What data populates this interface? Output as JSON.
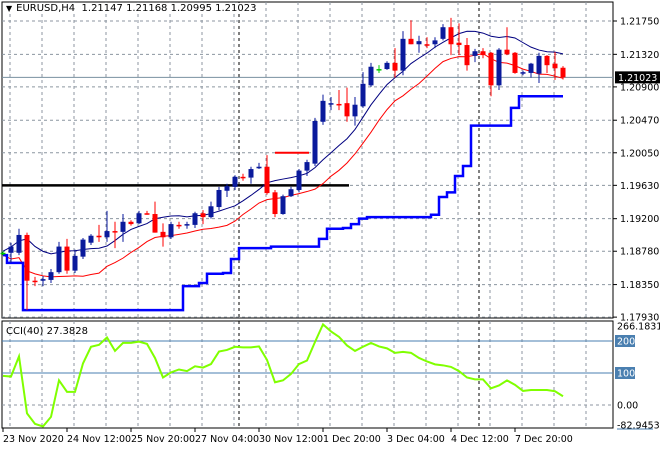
{
  "header": {
    "symbol": "EURUSD,H4",
    "ohlc": "1.21147 1.21168 1.20995 1.21023"
  },
  "cci_header": {
    "label": "CCI(40)",
    "value": "27.3828"
  },
  "current_price_label": "1.21023",
  "colors": {
    "bull": "#0a1a9c",
    "bear": "#ff0000",
    "doji": "#00cc00",
    "upper_ma": "#000080",
    "lower_ma": "#ff0000",
    "channel_low": "#0000ff",
    "cci": "#80ff00",
    "level_fill": "#4a7fb0"
  },
  "chart_data": [
    {
      "type": "candlestick",
      "title": "EURUSD,H4",
      "y_ticks": [
        "1.21750",
        "1.21320",
        "1.20900",
        "1.20470",
        "1.20050",
        "1.19630",
        "1.19200",
        "1.18780",
        "1.18350",
        "1.17930"
      ],
      "y_tick_values": [
        1.2175,
        1.2132,
        1.209,
        1.2047,
        1.2005,
        1.1963,
        1.192,
        1.1878,
        1.1835,
        1.1793
      ],
      "x_labels": [
        "23 Nov 2020",
        "24 Nov 12:00",
        "25 Nov 20:00",
        "27 Nov 04:00",
        "30 Nov 12:00",
        "1 Dec 20:00",
        "3 Dec 04:00",
        "4 Dec 12:00",
        "7 Dec 20:00"
      ],
      "x_label_candle_index": [
        0,
        8,
        16,
        24,
        32,
        40,
        48,
        56,
        64
      ],
      "period_separators_candle_index": [
        29,
        59
      ],
      "horizontal_lines": [
        {
          "price": 1.1963,
          "color": "#000000",
          "from_index": 0,
          "to_index": 43
        },
        {
          "price": 1.2005,
          "color": "#ff0000",
          "from_index": 34,
          "to_index": 38
        }
      ],
      "ohlc": [
        [
          1.1876,
          1.1878,
          1.1873,
          1.1876
        ],
        [
          1.1876,
          1.1889,
          1.1863,
          1.1884
        ],
        [
          1.1876,
          1.1907,
          1.1873,
          1.1899
        ],
        [
          1.1899,
          1.1902,
          1.1802,
          1.184
        ],
        [
          1.184,
          1.1845,
          1.1833,
          1.1839
        ],
        [
          1.184,
          1.1846,
          1.1833,
          1.1842
        ],
        [
          1.1841,
          1.1855,
          1.1837,
          1.1851
        ],
        [
          1.1851,
          1.189,
          1.1849,
          1.1884
        ],
        [
          1.1884,
          1.1894,
          1.1849,
          1.1853
        ],
        [
          1.1853,
          1.188,
          1.185,
          1.1872
        ],
        [
          1.1871,
          1.1895,
          1.1868,
          1.1893
        ],
        [
          1.1889,
          1.19,
          1.1886,
          1.1898
        ],
        [
          1.1898,
          1.1912,
          1.189,
          1.1896
        ],
        [
          1.1896,
          1.193,
          1.189,
          1.1904
        ],
        [
          1.1904,
          1.1916,
          1.1882,
          1.1903
        ],
        [
          1.1903,
          1.1926,
          1.189,
          1.1916
        ],
        [
          1.1916,
          1.1918,
          1.1911,
          1.1913
        ],
        [
          1.1914,
          1.193,
          1.1913,
          1.1927
        ],
        [
          1.1927,
          1.193,
          1.1925,
          1.1926
        ],
        [
          1.1926,
          1.1942,
          1.1902,
          1.1902
        ],
        [
          1.1903,
          1.1914,
          1.1884,
          1.1896
        ],
        [
          1.1896,
          1.1916,
          1.1894,
          1.1913
        ],
        [
          1.1912,
          1.1916,
          1.1907,
          1.1911
        ],
        [
          1.1912,
          1.1916,
          1.1907,
          1.1913
        ],
        [
          1.1912,
          1.1929,
          1.1908,
          1.1927
        ],
        [
          1.1927,
          1.1931,
          1.1913,
          1.1922
        ],
        [
          1.1922,
          1.1942,
          1.192,
          1.1936
        ],
        [
          1.1935,
          1.1961,
          1.1931,
          1.1957
        ],
        [
          1.1956,
          1.1965,
          1.1948,
          1.1962
        ],
        [
          1.1961,
          1.1976,
          1.1957,
          1.1974
        ],
        [
          1.1974,
          1.1978,
          1.1969,
          1.1973
        ],
        [
          1.1973,
          1.1987,
          1.1965,
          1.1984
        ],
        [
          1.1985,
          1.1992,
          1.1984,
          1.1987
        ],
        [
          1.1987,
          1.2002,
          1.1951,
          1.1953
        ],
        [
          1.1954,
          1.1957,
          1.1922,
          1.1926
        ],
        [
          1.1926,
          1.1951,
          1.1925,
          1.1949
        ],
        [
          1.1949,
          1.1961,
          1.1948,
          1.1958
        ],
        [
          1.1957,
          1.1984,
          1.1954,
          1.1982
        ],
        [
          1.1982,
          1.1996,
          1.1975,
          1.1993
        ],
        [
          1.1991,
          1.205,
          1.1988,
          1.2046
        ],
        [
          1.2045,
          1.208,
          1.2041,
          1.2072
        ],
        [
          1.2068,
          1.2077,
          1.206,
          1.2069
        ],
        [
          1.2068,
          1.2086,
          1.206,
          1.2067
        ],
        [
          1.2069,
          1.2089,
          1.2045,
          1.2052
        ],
        [
          1.2052,
          1.2077,
          1.204,
          1.2067
        ],
        [
          1.2065,
          1.2109,
          1.2063,
          1.2094
        ],
        [
          1.2092,
          1.2121,
          1.209,
          1.2116
        ],
        [
          1.2113,
          1.2118,
          1.2108,
          1.2113
        ],
        [
          1.2113,
          1.2123,
          1.2112,
          1.2121
        ],
        [
          1.2121,
          1.214,
          1.2102,
          1.2111
        ],
        [
          1.2111,
          1.2162,
          1.2105,
          1.2152
        ],
        [
          1.2152,
          1.2176,
          1.2145,
          1.2145
        ],
        [
          1.2145,
          1.2156,
          1.2134,
          1.2149
        ],
        [
          1.2145,
          1.2154,
          1.214,
          1.2144
        ],
        [
          1.2145,
          1.2154,
          1.214,
          1.215
        ],
        [
          1.2152,
          1.2171,
          1.215,
          1.2167
        ],
        [
          1.2167,
          1.2179,
          1.2131,
          1.2145
        ],
        [
          1.2147,
          1.2172,
          1.2131,
          1.2144
        ],
        [
          1.2144,
          1.2153,
          1.2111,
          1.2118
        ],
        [
          1.213,
          1.2139,
          1.2122,
          1.2136
        ],
        [
          1.2136,
          1.214,
          1.2127,
          1.2131
        ],
        [
          1.2134,
          1.2135,
          1.2078,
          1.2092
        ],
        [
          1.2092,
          1.214,
          1.2086,
          1.2138
        ],
        [
          1.2138,
          1.2167,
          1.2131,
          1.2132
        ],
        [
          1.2134,
          1.2135,
          1.2107,
          1.2108
        ],
        [
          1.2107,
          1.2111,
          1.2105,
          1.2109
        ],
        [
          1.2108,
          1.2121,
          1.2102,
          1.212
        ],
        [
          1.2107,
          1.2134,
          1.2095,
          1.213
        ],
        [
          1.213,
          1.2131,
          1.2108,
          1.2118
        ],
        [
          1.212,
          1.2135,
          1.2099,
          1.2114
        ],
        [
          1.21147,
          1.21168,
          1.20995,
          1.21023
        ]
      ],
      "current_price": 1.21023
    },
    {
      "type": "line",
      "title": "CCI(40)",
      "y_ticks": [
        "266.1831",
        "200",
        "100",
        "0.00",
        "-82.9453"
      ],
      "ylim": [
        -82.9453,
        266.1831
      ],
      "levels": [
        200,
        100,
        0
      ],
      "values": [
        91,
        89,
        152,
        -26,
        -59,
        -67,
        -37,
        77,
        41,
        41,
        130,
        182,
        188,
        211,
        169,
        194,
        194,
        198,
        191,
        147,
        86,
        102,
        111,
        106,
        121,
        117,
        128,
        167,
        172,
        182,
        180,
        180,
        183,
        141,
        71,
        77,
        97,
        128,
        139,
        197,
        252,
        230,
        213,
        186,
        169,
        182,
        194,
        183,
        177,
        163,
        166,
        163,
        147,
        136,
        127,
        124,
        119,
        106,
        86,
        80,
        80,
        52,
        61,
        77,
        63,
        44,
        47,
        47,
        47,
        43,
        27.3828
      ]
    }
  ]
}
